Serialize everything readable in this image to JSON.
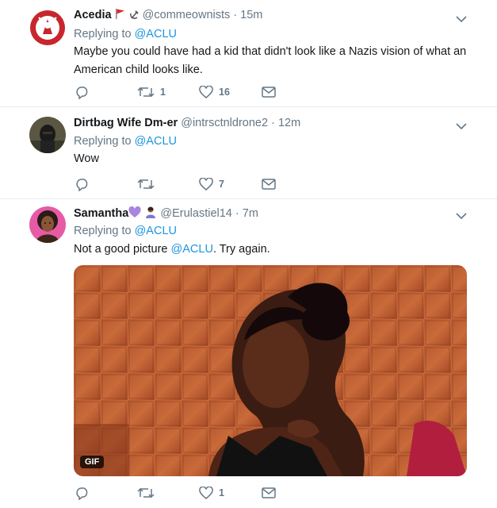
{
  "tweets": [
    {
      "name": "Acedia",
      "emoji_suffix": "🚩☭",
      "handle": "@commeownists",
      "time": "15m",
      "replying_prefix": "Replying to",
      "replying_handle": "@ACLU",
      "text": "Maybe you could have had a kid that didn't look like a Nazis vision of what an American child looks like.",
      "replies": "",
      "retweets": "1",
      "likes": "16"
    },
    {
      "name": "Dirtbag Wife Dm-er",
      "handle": "@intrsctnldrone2",
      "time": "12m",
      "replying_prefix": "Replying to",
      "replying_handle": "@ACLU",
      "text": "Wow",
      "replies": "",
      "retweets": "",
      "likes": "7"
    },
    {
      "name": "Samantha",
      "emoji_suffix": "💜🙇🏽‍♀️",
      "handle": "@Erulastiel14",
      "time": "7m",
      "replying_prefix": "Replying to",
      "replying_handle": "@ACLU",
      "text_before": "Not a good picture ",
      "text_mention": "@ACLU",
      "text_after": ". Try again.",
      "gif_label": "GIF",
      "replies": "",
      "retweets": "",
      "likes": "1"
    }
  ],
  "separator": "·",
  "colors": {
    "link": "#1b95e0",
    "meta": "#657786",
    "divider": "#e6ecf0",
    "text": "#14171a"
  },
  "icons": [
    "reply-icon",
    "retweet-icon",
    "like-icon",
    "dm-icon",
    "chevron-down-icon"
  ]
}
